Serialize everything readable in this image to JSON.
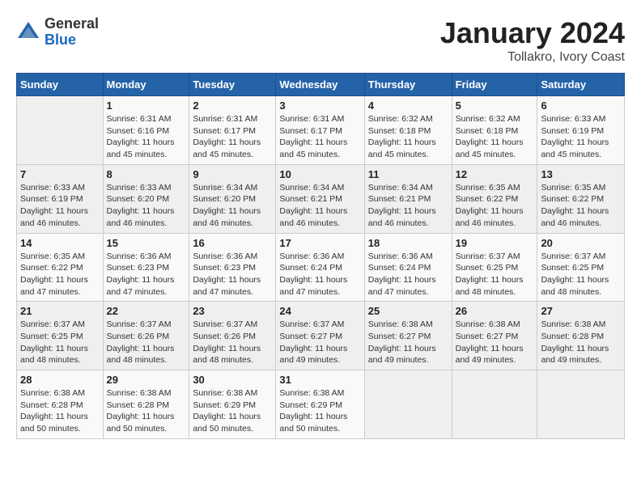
{
  "logo": {
    "general": "General",
    "blue": "Blue"
  },
  "title": "January 2024",
  "subtitle": "Tollakro, Ivory Coast",
  "days_of_week": [
    "Sunday",
    "Monday",
    "Tuesday",
    "Wednesday",
    "Thursday",
    "Friday",
    "Saturday"
  ],
  "weeks": [
    [
      {
        "day": "",
        "info": ""
      },
      {
        "day": "1",
        "info": "Sunrise: 6:31 AM\nSunset: 6:16 PM\nDaylight: 11 hours\nand 45 minutes."
      },
      {
        "day": "2",
        "info": "Sunrise: 6:31 AM\nSunset: 6:17 PM\nDaylight: 11 hours\nand 45 minutes."
      },
      {
        "day": "3",
        "info": "Sunrise: 6:31 AM\nSunset: 6:17 PM\nDaylight: 11 hours\nand 45 minutes."
      },
      {
        "day": "4",
        "info": "Sunrise: 6:32 AM\nSunset: 6:18 PM\nDaylight: 11 hours\nand 45 minutes."
      },
      {
        "day": "5",
        "info": "Sunrise: 6:32 AM\nSunset: 6:18 PM\nDaylight: 11 hours\nand 45 minutes."
      },
      {
        "day": "6",
        "info": "Sunrise: 6:33 AM\nSunset: 6:19 PM\nDaylight: 11 hours\nand 45 minutes."
      }
    ],
    [
      {
        "day": "7",
        "info": "Sunrise: 6:33 AM\nSunset: 6:19 PM\nDaylight: 11 hours\nand 46 minutes."
      },
      {
        "day": "8",
        "info": "Sunrise: 6:33 AM\nSunset: 6:20 PM\nDaylight: 11 hours\nand 46 minutes."
      },
      {
        "day": "9",
        "info": "Sunrise: 6:34 AM\nSunset: 6:20 PM\nDaylight: 11 hours\nand 46 minutes."
      },
      {
        "day": "10",
        "info": "Sunrise: 6:34 AM\nSunset: 6:21 PM\nDaylight: 11 hours\nand 46 minutes."
      },
      {
        "day": "11",
        "info": "Sunrise: 6:34 AM\nSunset: 6:21 PM\nDaylight: 11 hours\nand 46 minutes."
      },
      {
        "day": "12",
        "info": "Sunrise: 6:35 AM\nSunset: 6:22 PM\nDaylight: 11 hours\nand 46 minutes."
      },
      {
        "day": "13",
        "info": "Sunrise: 6:35 AM\nSunset: 6:22 PM\nDaylight: 11 hours\nand 46 minutes."
      }
    ],
    [
      {
        "day": "14",
        "info": "Sunrise: 6:35 AM\nSunset: 6:22 PM\nDaylight: 11 hours\nand 47 minutes."
      },
      {
        "day": "15",
        "info": "Sunrise: 6:36 AM\nSunset: 6:23 PM\nDaylight: 11 hours\nand 47 minutes."
      },
      {
        "day": "16",
        "info": "Sunrise: 6:36 AM\nSunset: 6:23 PM\nDaylight: 11 hours\nand 47 minutes."
      },
      {
        "day": "17",
        "info": "Sunrise: 6:36 AM\nSunset: 6:24 PM\nDaylight: 11 hours\nand 47 minutes."
      },
      {
        "day": "18",
        "info": "Sunrise: 6:36 AM\nSunset: 6:24 PM\nDaylight: 11 hours\nand 47 minutes."
      },
      {
        "day": "19",
        "info": "Sunrise: 6:37 AM\nSunset: 6:25 PM\nDaylight: 11 hours\nand 48 minutes."
      },
      {
        "day": "20",
        "info": "Sunrise: 6:37 AM\nSunset: 6:25 PM\nDaylight: 11 hours\nand 48 minutes."
      }
    ],
    [
      {
        "day": "21",
        "info": "Sunrise: 6:37 AM\nSunset: 6:25 PM\nDaylight: 11 hours\nand 48 minutes."
      },
      {
        "day": "22",
        "info": "Sunrise: 6:37 AM\nSunset: 6:26 PM\nDaylight: 11 hours\nand 48 minutes."
      },
      {
        "day": "23",
        "info": "Sunrise: 6:37 AM\nSunset: 6:26 PM\nDaylight: 11 hours\nand 48 minutes."
      },
      {
        "day": "24",
        "info": "Sunrise: 6:37 AM\nSunset: 6:27 PM\nDaylight: 11 hours\nand 49 minutes."
      },
      {
        "day": "25",
        "info": "Sunrise: 6:38 AM\nSunset: 6:27 PM\nDaylight: 11 hours\nand 49 minutes."
      },
      {
        "day": "26",
        "info": "Sunrise: 6:38 AM\nSunset: 6:27 PM\nDaylight: 11 hours\nand 49 minutes."
      },
      {
        "day": "27",
        "info": "Sunrise: 6:38 AM\nSunset: 6:28 PM\nDaylight: 11 hours\nand 49 minutes."
      }
    ],
    [
      {
        "day": "28",
        "info": "Sunrise: 6:38 AM\nSunset: 6:28 PM\nDaylight: 11 hours\nand 50 minutes."
      },
      {
        "day": "29",
        "info": "Sunrise: 6:38 AM\nSunset: 6:28 PM\nDaylight: 11 hours\nand 50 minutes."
      },
      {
        "day": "30",
        "info": "Sunrise: 6:38 AM\nSunset: 6:29 PM\nDaylight: 11 hours\nand 50 minutes."
      },
      {
        "day": "31",
        "info": "Sunrise: 6:38 AM\nSunset: 6:29 PM\nDaylight: 11 hours\nand 50 minutes."
      },
      {
        "day": "",
        "info": ""
      },
      {
        "day": "",
        "info": ""
      },
      {
        "day": "",
        "info": ""
      }
    ]
  ]
}
